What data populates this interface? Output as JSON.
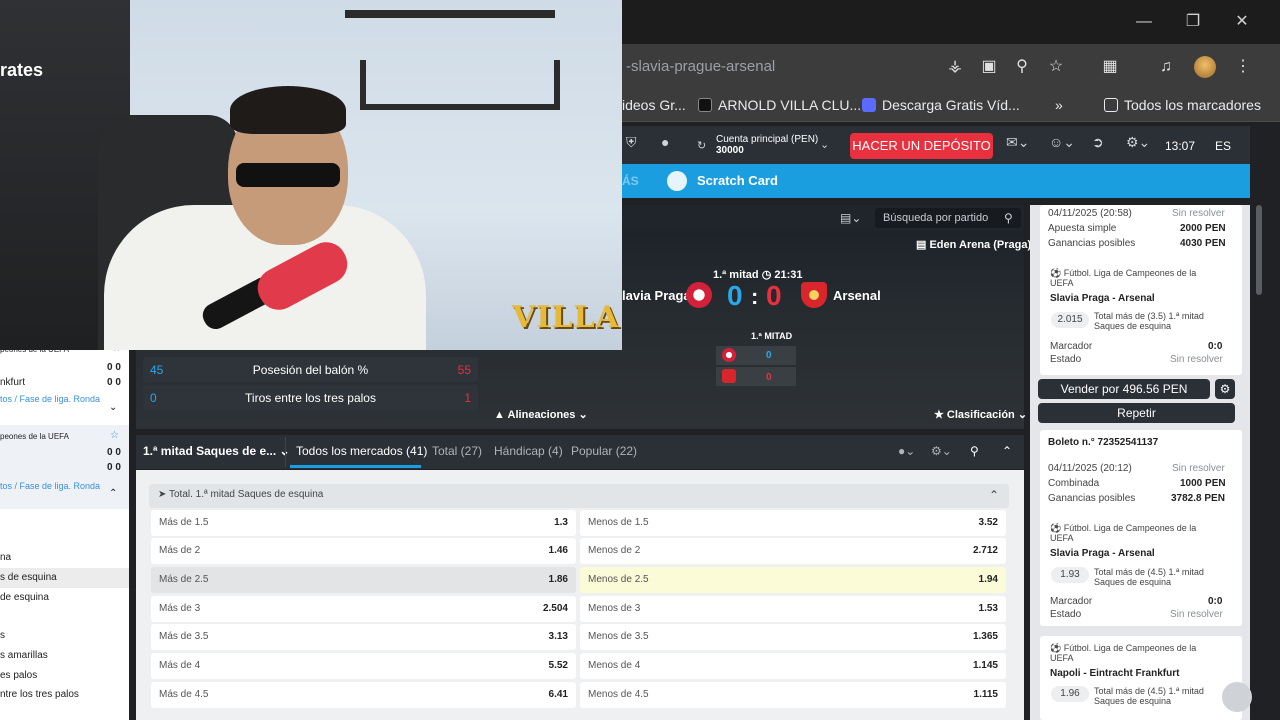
{
  "browser": {
    "url_fragment": "-slavia-prague-arsenal",
    "bookmarks": [
      "ideos Gr...",
      "ARNOLD VILLA CLU...",
      "Descarga Gratis Víd..."
    ],
    "all_bookmarks": "Todos los marcadores",
    "more_chevron": "»"
  },
  "header": {
    "account_label": "Cuenta principal (PEN)",
    "account_balance": "30000",
    "deposit_button": "HACER UN DEPÓSITO",
    "time": "13:07",
    "language": "ES",
    "nav_more": "ÁS",
    "scratch_card": "Scratch Card"
  },
  "match": {
    "search_placeholder": "Búsqueda por partido",
    "venue": "Eden Arena (Praga)",
    "period": "1.ª mitad",
    "clock": "21:31",
    "home_team": "lavia Praga",
    "away_team": "Arsenal",
    "home_score": "0",
    "separator": ":",
    "away_score": "0",
    "half_label": "1.ª MITAD",
    "half_home": "0",
    "half_away": "0",
    "lineups": "Alineaciones",
    "standings": "Clasificación"
  },
  "stats": [
    {
      "name": "Posesión del balón %",
      "home": "45",
      "away": "55"
    },
    {
      "name": "Tiros entre los tres palos",
      "home": "0",
      "away": "1"
    }
  ],
  "sidebar": {
    "lines": [
      {
        "text": "peones de la UEFA",
        "score": ""
      },
      {
        "text": "nkfurt",
        "score": "0 0"
      },
      {
        "text": "tos / Fase de liga. Ronda",
        "score": ""
      },
      {
        "text": "peones de la UEFA",
        "score": ""
      },
      {
        "text": "",
        "score": "0 0"
      },
      {
        "text": "",
        "score": "0 0"
      },
      {
        "text": "tos / Fase de liga. Ronda",
        "score": ""
      }
    ],
    "markets": [
      "na",
      "s de esquina",
      "de esquina",
      "s",
      "s amarillas",
      "es palos",
      "ntre los tres palos"
    ]
  },
  "tabs": {
    "first": "1.ª mitad Saques de e...",
    "items": [
      "Todos los mercados (41)",
      "Total (27)",
      "Hándicap (4)",
      "Popular (22)"
    ]
  },
  "market": {
    "title": "Total. 1.ª mitad Saques de esquina",
    "rows": [
      {
        "over_label": "Más de 1.5",
        "over_odd": "1.3",
        "under_label": "Menos de 1.5",
        "under_odd": "3.52"
      },
      {
        "over_label": "Más de 2",
        "over_odd": "1.46",
        "under_label": "Menos de 2",
        "under_odd": "2.712"
      },
      {
        "over_label": "Más de 2.5",
        "over_odd": "1.86",
        "under_label": "Menos de 2.5",
        "under_odd": "1.94"
      },
      {
        "over_label": "Más de 3",
        "over_odd": "2.504",
        "under_label": "Menos de 3",
        "under_odd": "1.53"
      },
      {
        "over_label": "Más de 3.5",
        "over_odd": "3.13",
        "under_label": "Menos de 3.5",
        "under_odd": "1.365"
      },
      {
        "over_label": "Más de 4",
        "over_odd": "5.52",
        "under_label": "Menos de 4",
        "under_odd": "1.145"
      },
      {
        "over_label": "Más de 4.5",
        "over_odd": "6.41",
        "under_label": "Menos de 4.5",
        "under_odd": "1.115"
      }
    ]
  },
  "slip": {
    "bet1": {
      "date": "04/11/2025 (20:58)",
      "status": "Sin resolver",
      "type": "Apuesta simple",
      "stake": "2000 PEN",
      "gains_label": "Ganancias posibles",
      "gains": "4030 PEN",
      "league": "Fútbol. Liga de Campeones de la UEFA",
      "event": "Slavia Praga - Arsenal",
      "odd": "2.015",
      "selection": "Total más de (3.5) 1.ª mitad Saques de esquina",
      "marker_label": "Marcador",
      "marker": "0:0",
      "state_label": "Estado",
      "state": "Sin resolver"
    },
    "sell_button": "Vender por 496.56 PEN",
    "repeat_button": "Repetir",
    "bet2": {
      "ticket": "Boleto n.° 72352541137",
      "date": "04/11/2025 (20:12)",
      "status": "Sin resolver",
      "type": "Combinada",
      "stake": "1000 PEN",
      "gains_label": "Ganancias posibles",
      "gains": "3782.8 PEN",
      "league": "Fútbol. Liga de Campeones de la UEFA",
      "event": "Slavia Praga - Arsenal",
      "odd": "1.93",
      "selection": "Total más de (4.5) 1.ª mitad Saques de esquina",
      "marker_label": "Marcador",
      "marker": "0:0",
      "state_label": "Estado",
      "state": "Sin resolver"
    },
    "bet3": {
      "league": "Fútbol. Liga de Campeones de la UEFA",
      "event": "Napoli - Eintracht Frankfurt",
      "odd": "1.96",
      "selection": "Total más de (4.5) 1.ª mitad Saques de esquina"
    }
  },
  "overlay": {
    "streamer_logo": "VILLA",
    "poster_text": "rates"
  },
  "colors": {
    "accent_blue": "#1a9ee0",
    "deposit_red": "#e8303e",
    "home_color": "#2aa7ea",
    "away_color": "#e8303e"
  }
}
